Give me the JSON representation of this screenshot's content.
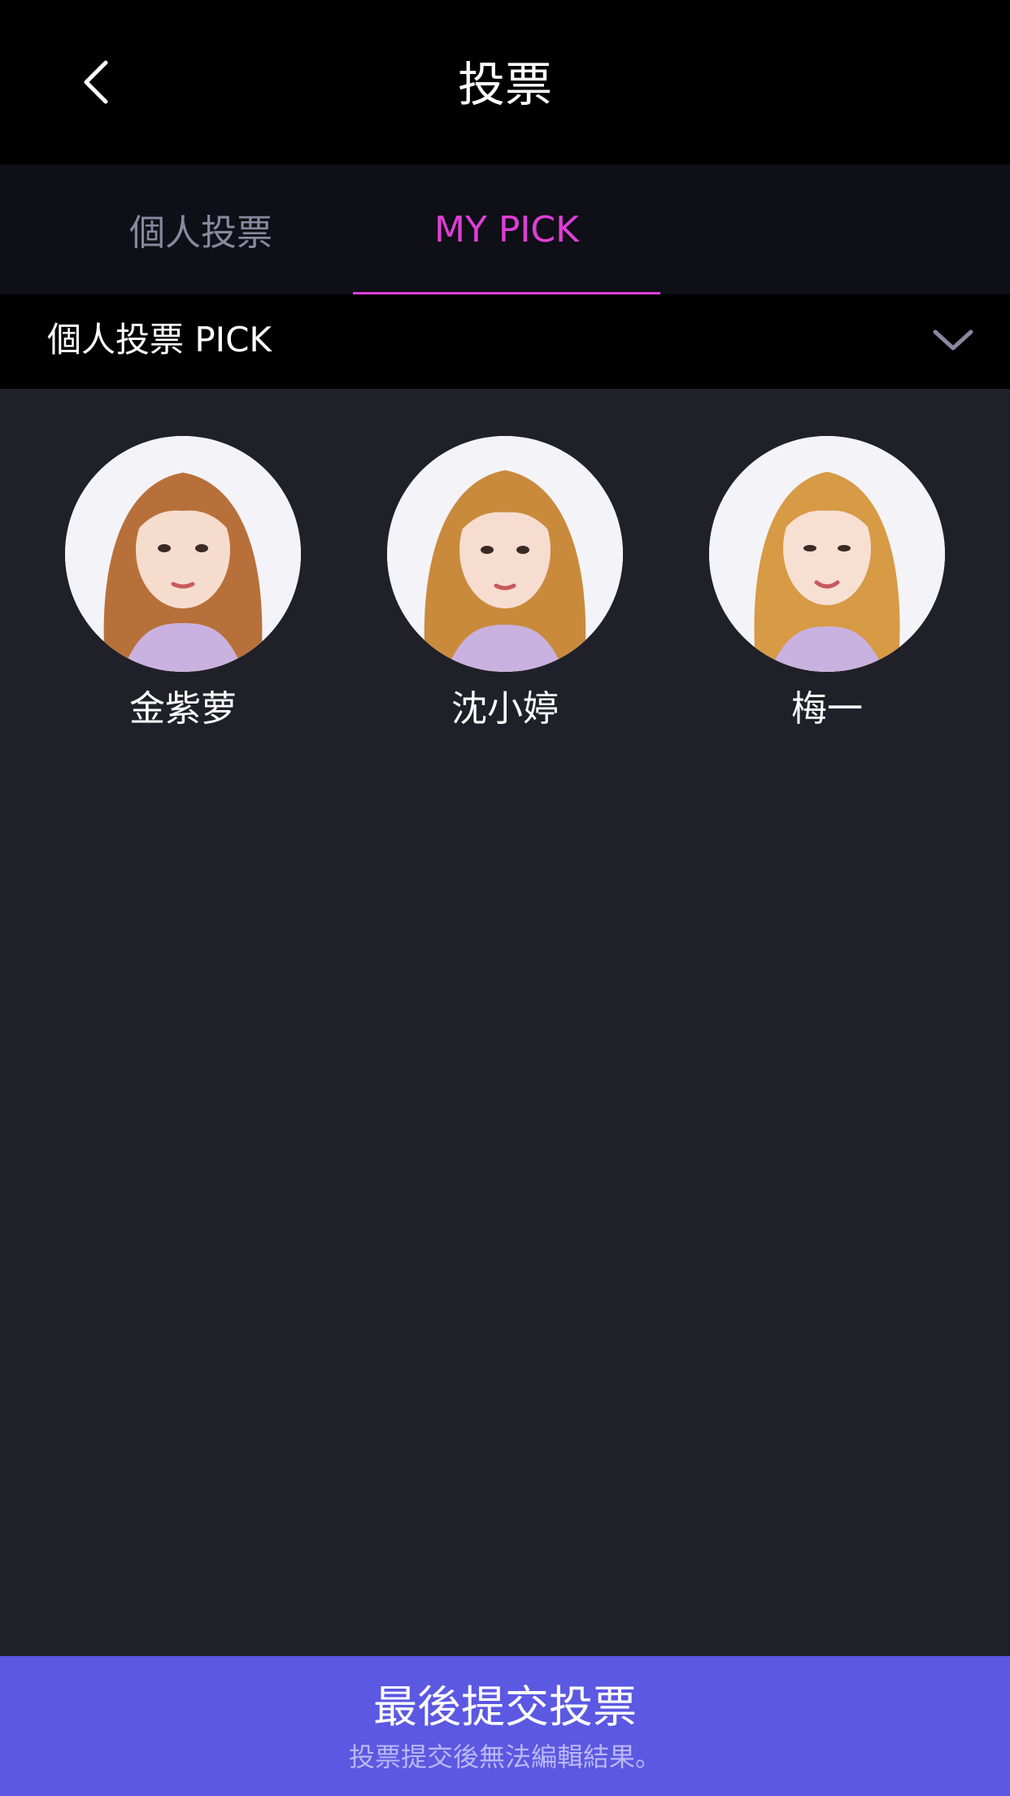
{
  "header": {
    "back_icon": "chevron-left-icon",
    "title": "投票"
  },
  "tabs": [
    {
      "label": "個人投票",
      "active": false
    },
    {
      "label": "MY PICK",
      "active": true
    }
  ],
  "filter": {
    "label": "個人投票 PICK",
    "chevron_icon": "chevron-down-icon"
  },
  "picks": [
    {
      "name": "金紫萝",
      "hair": "#b8703a"
    },
    {
      "name": "沈小婷",
      "hair": "#c98a3c"
    },
    {
      "name": "梅一",
      "hair": "#d79a45"
    }
  ],
  "submit": {
    "title": "最後提交投票",
    "subtitle": "投票提交後無法編輯結果。"
  },
  "colors": {
    "accent": "#e03ed6",
    "submit_bg": "#5b58e2",
    "content_bg": "#202029",
    "tab_bg": "#0f0f17"
  }
}
